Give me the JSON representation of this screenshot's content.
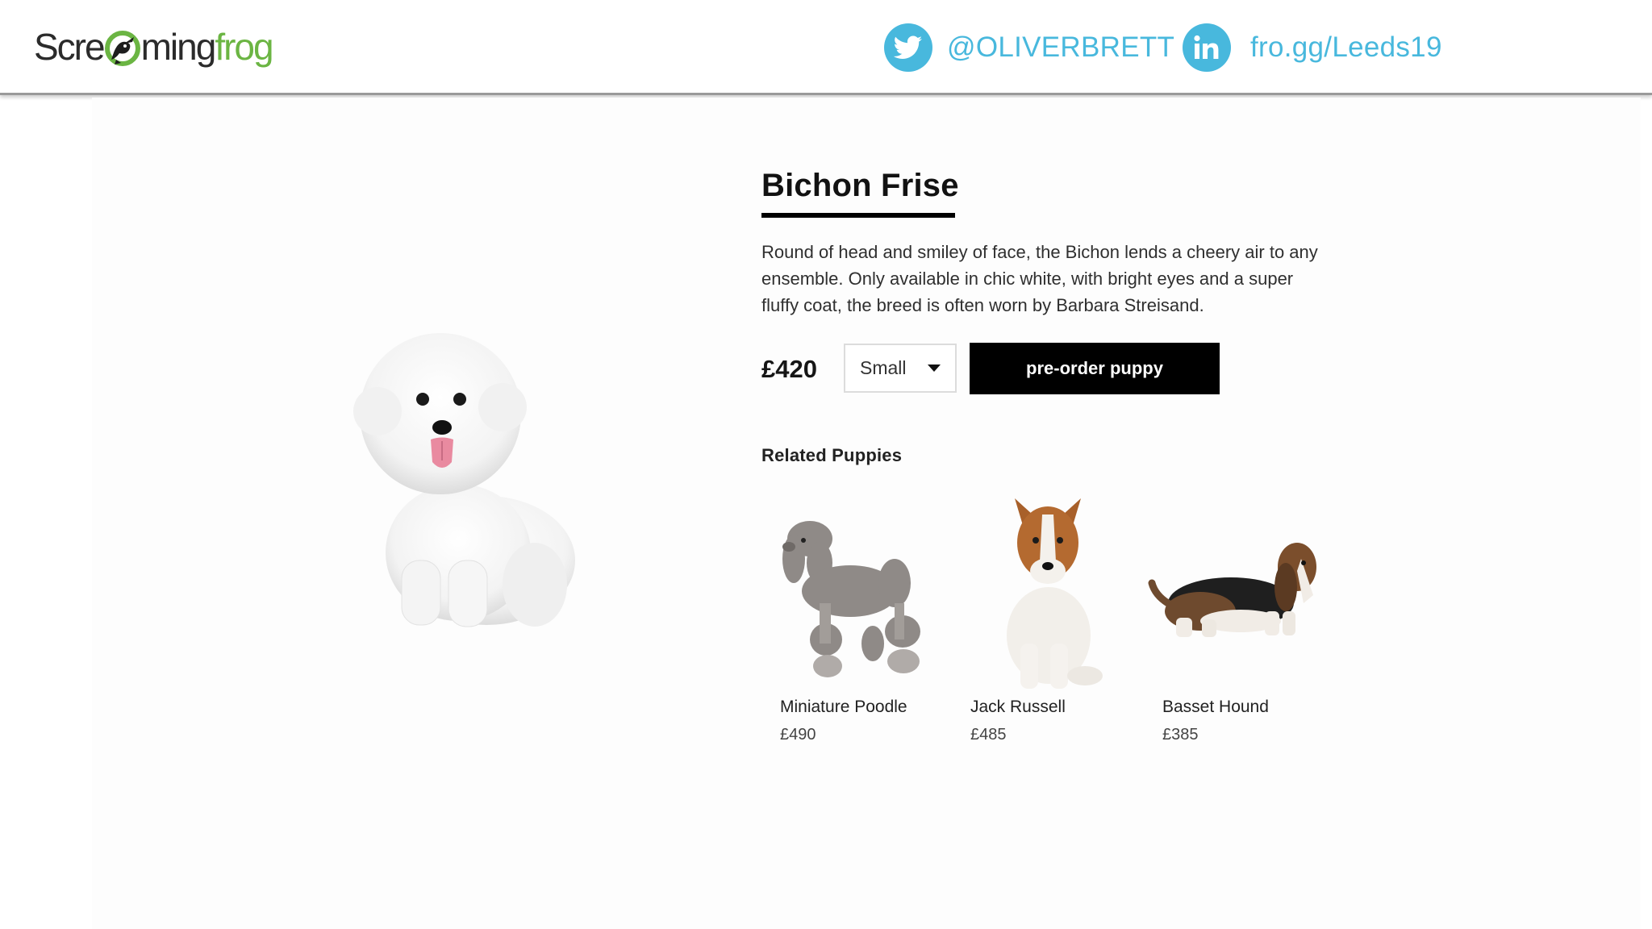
{
  "header": {
    "logo": {
      "part1": "Scre",
      "part2": "ming",
      "part3": "frog"
    },
    "twitter": {
      "icon": "twitter-icon",
      "handle": "@OLIVERBRETT"
    },
    "linkedin": {
      "icon": "linkedin-icon",
      "handle": "fro.gg/Leeds19"
    },
    "colors": {
      "accent": "#48b8dd",
      "logo_green": "#6bb543"
    }
  },
  "product": {
    "title": "Bichon Frise",
    "description": "Round of head and smiley of face, the Bichon lends a cheery air to any ensemble. Only available in chic white, with bright eyes and a super fluffy coat, the breed is often worn by Barbara Streisand.",
    "price": "£420",
    "size_select": {
      "selected": "Small"
    },
    "preorder_label": "pre-order puppy"
  },
  "related": {
    "heading": "Related Puppies",
    "items": [
      {
        "name": "Miniature Poodle",
        "price": "£490"
      },
      {
        "name": "Jack Russell",
        "price": "£485"
      },
      {
        "name": "Basset Hound",
        "price": "£385"
      }
    ]
  }
}
